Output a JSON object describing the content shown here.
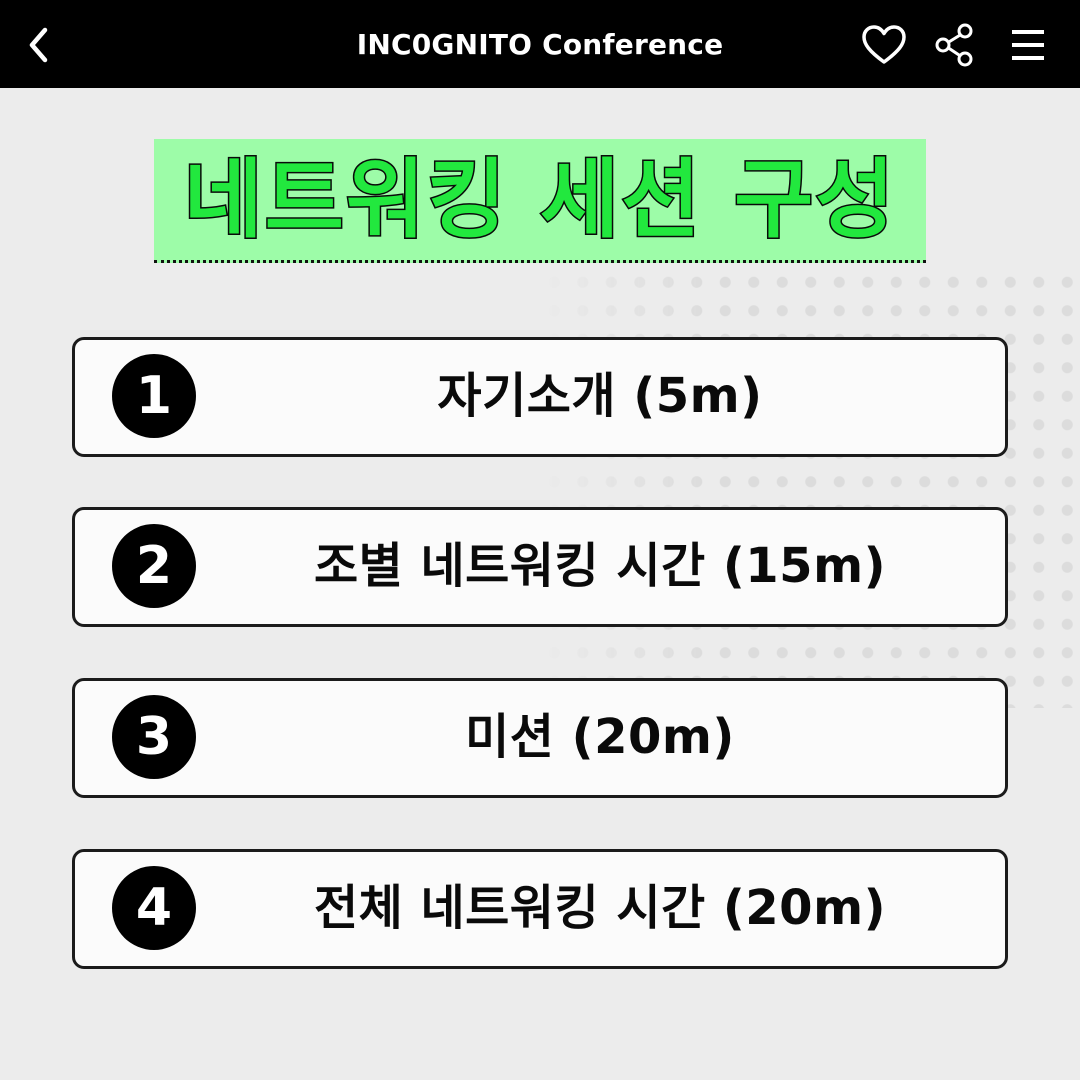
{
  "header": {
    "title": "INC0GNITO Conference",
    "back_icon": "chevron-left-icon",
    "like_icon": "heart-icon",
    "share_icon": "share-icon",
    "menu_icon": "hamburger-menu-icon"
  },
  "heading": {
    "text": "네트워킹 세션 구성"
  },
  "sessions": [
    {
      "number": "1",
      "label": "자기소개 (5m)"
    },
    {
      "number": "2",
      "label": "조별 네트워킹 시간 (15m)"
    },
    {
      "number": "3",
      "label": "미션 (20m)"
    },
    {
      "number": "4",
      "label": "전체 네트워킹 시간 (20m)"
    }
  ],
  "colors": {
    "header_background": "#000000",
    "page_background": "#ececec",
    "heading_highlight": "#9dfca8",
    "heading_text": "#22e83e"
  }
}
